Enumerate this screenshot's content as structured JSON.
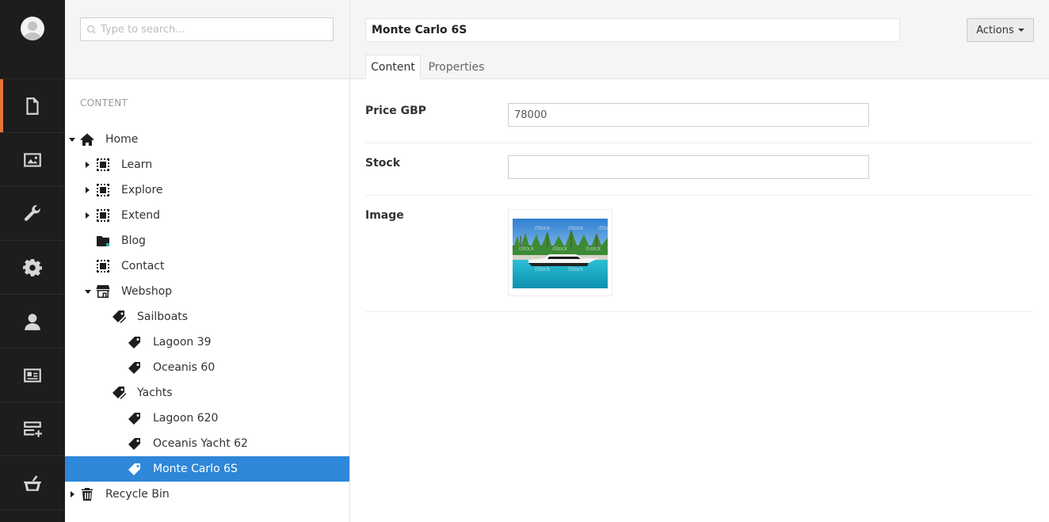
{
  "search": {
    "placeholder": "Type to search..."
  },
  "sections": [
    "content",
    "media",
    "settings",
    "developer",
    "users",
    "members",
    "forms",
    "commerce"
  ],
  "tree": {
    "title": "CONTENT",
    "nodes": [
      {
        "label": "Home",
        "icon": "home-icon",
        "expanded": true
      },
      {
        "label": "Learn",
        "icon": "dashed-box-icon",
        "expanded": false
      },
      {
        "label": "Explore",
        "icon": "dashed-box-icon",
        "expanded": false
      },
      {
        "label": "Extend",
        "icon": "dashed-box-icon",
        "expanded": false
      },
      {
        "label": "Blog",
        "icon": "folder-icon"
      },
      {
        "label": "Contact",
        "icon": "dashed-box-icon"
      },
      {
        "label": "Webshop",
        "icon": "shop-icon",
        "expanded": true
      },
      {
        "label": "Sailboats",
        "icon": "tags-icon"
      },
      {
        "label": "Lagoon 39",
        "icon": "tag-icon"
      },
      {
        "label": "Oceanis 60",
        "icon": "tag-icon"
      },
      {
        "label": "Yachts",
        "icon": "tags-icon"
      },
      {
        "label": "Lagoon 620",
        "icon": "tag-icon"
      },
      {
        "label": "Oceanis Yacht 62",
        "icon": "tag-icon"
      },
      {
        "label": "Monte Carlo 6S",
        "icon": "tag-icon",
        "selected": true
      },
      {
        "label": "Recycle Bin",
        "icon": "trash-icon",
        "expanded": false
      }
    ]
  },
  "editor": {
    "name": "Monte Carlo 6S",
    "actions_label": "Actions",
    "tabs": [
      "Content",
      "Properties"
    ],
    "active_tab": "Content",
    "fields": [
      {
        "label": "Price GBP",
        "value": "78000"
      },
      {
        "label": "Stock",
        "value": ""
      },
      {
        "label": "Image",
        "watermark": "iStock"
      }
    ]
  },
  "colors": {
    "rail": "#1d1d1d",
    "active_accent": "#e8743b",
    "selection": "#2e87d8"
  }
}
